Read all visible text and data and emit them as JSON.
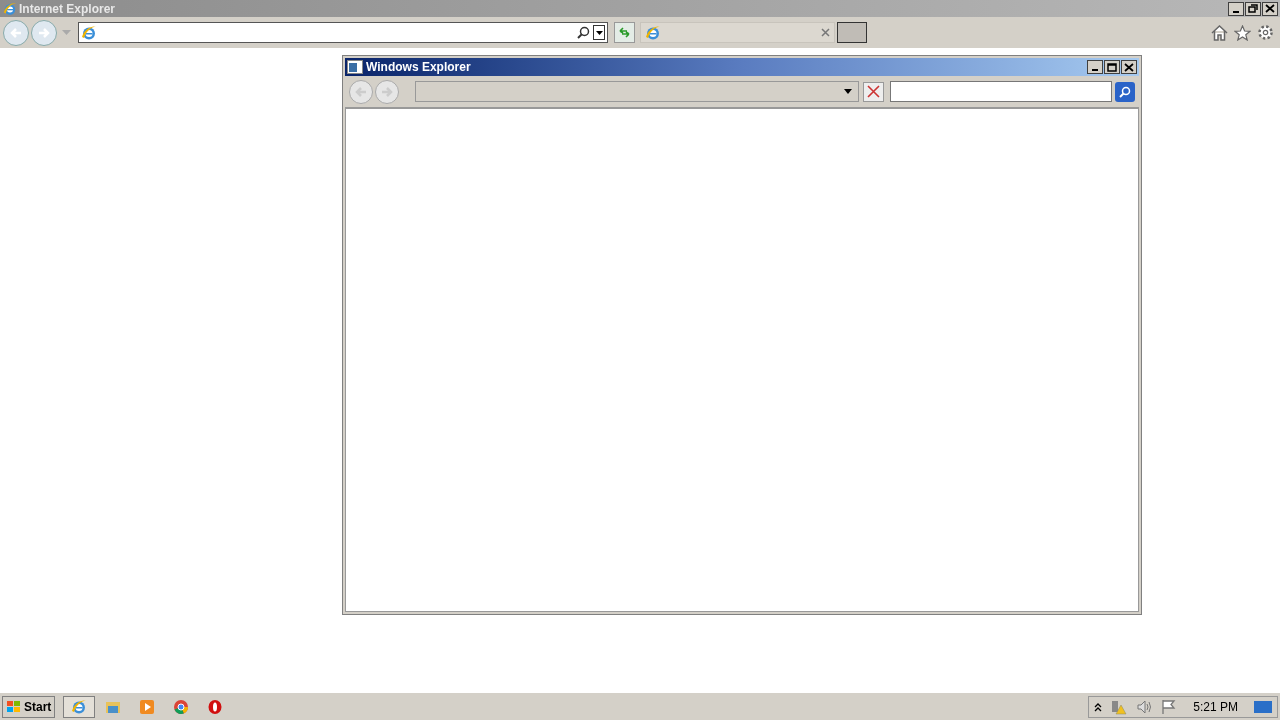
{
  "browser": {
    "title": "Internet Explorer"
  },
  "explorer_window": {
    "title": "Windows Explorer"
  },
  "taskbar": {
    "start_label": "Start",
    "items": [
      {
        "kind": "browser",
        "selected": true
      },
      {
        "kind": "folder",
        "selected": false
      },
      {
        "kind": "media",
        "selected": false
      },
      {
        "kind": "chrome",
        "selected": false
      },
      {
        "kind": "opera",
        "selected": false
      }
    ],
    "clock": "5:21 PM"
  }
}
